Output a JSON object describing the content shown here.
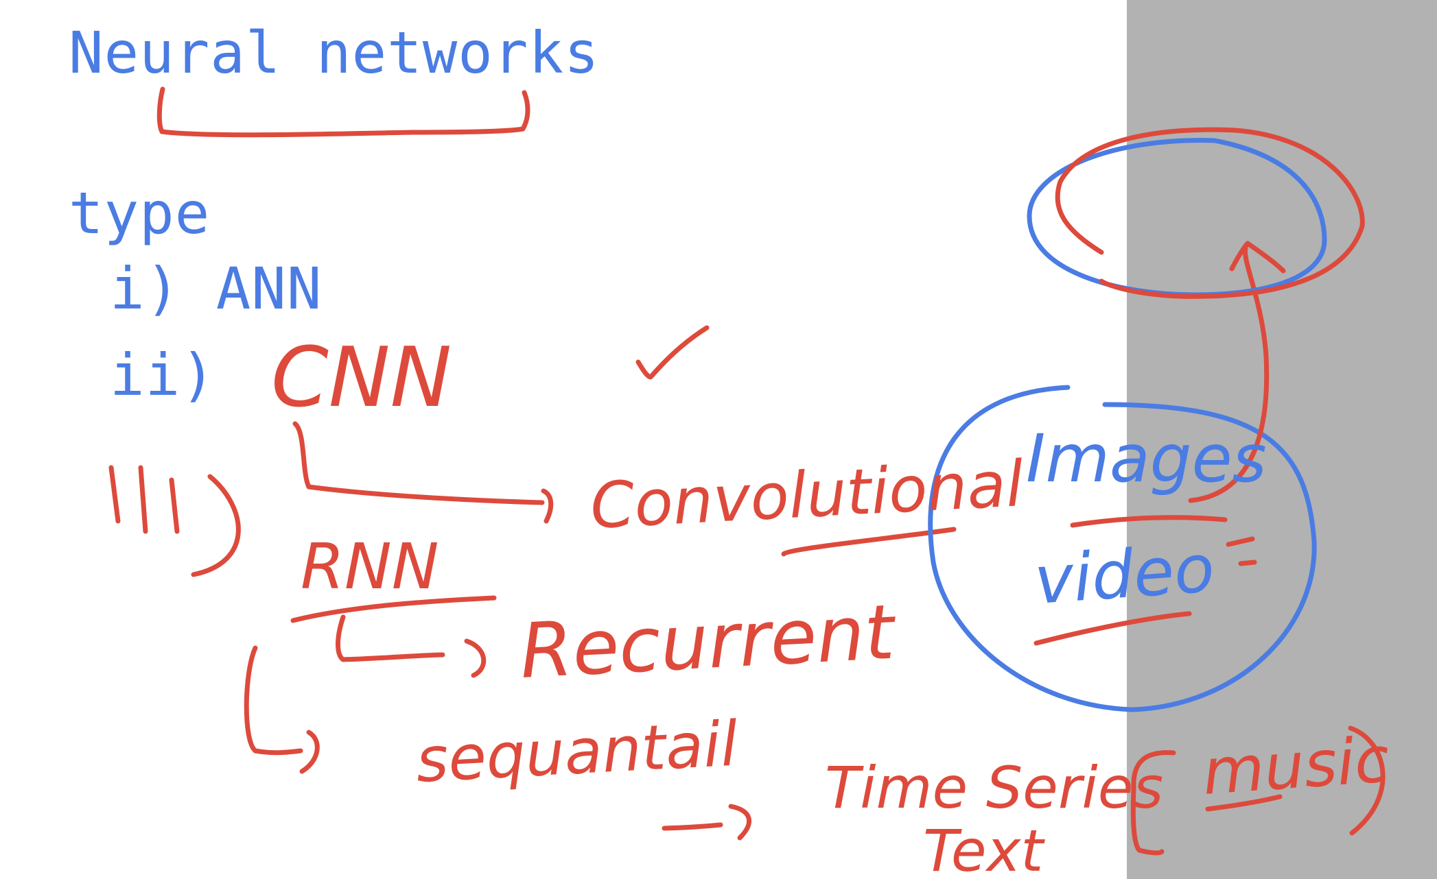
{
  "notes": {
    "title": "Neural networks",
    "heading_type": "type",
    "item_1": "i) ANN",
    "item_2_prefix": "ii)",
    "item_2_handwritten": "CNN",
    "item_3_prefix": "iii)",
    "item_3_handwritten": "RNN",
    "cnn_expansion": "Convolutional",
    "rnn_expansion": "Recurrent",
    "rnn_sub": "sequantail",
    "rnn_uses_line1": "Time Series",
    "rnn_uses_line2": "Text",
    "rnn_uses_bracket": "music",
    "cnn_uses_line1": "Images",
    "cnn_uses_line2": "video"
  },
  "colors": {
    "typed_text": "#4a7ce3",
    "red_ink": "#dd4a3c",
    "blue_ink": "#4a7ce3",
    "side_panel": "#b2b2b2"
  }
}
